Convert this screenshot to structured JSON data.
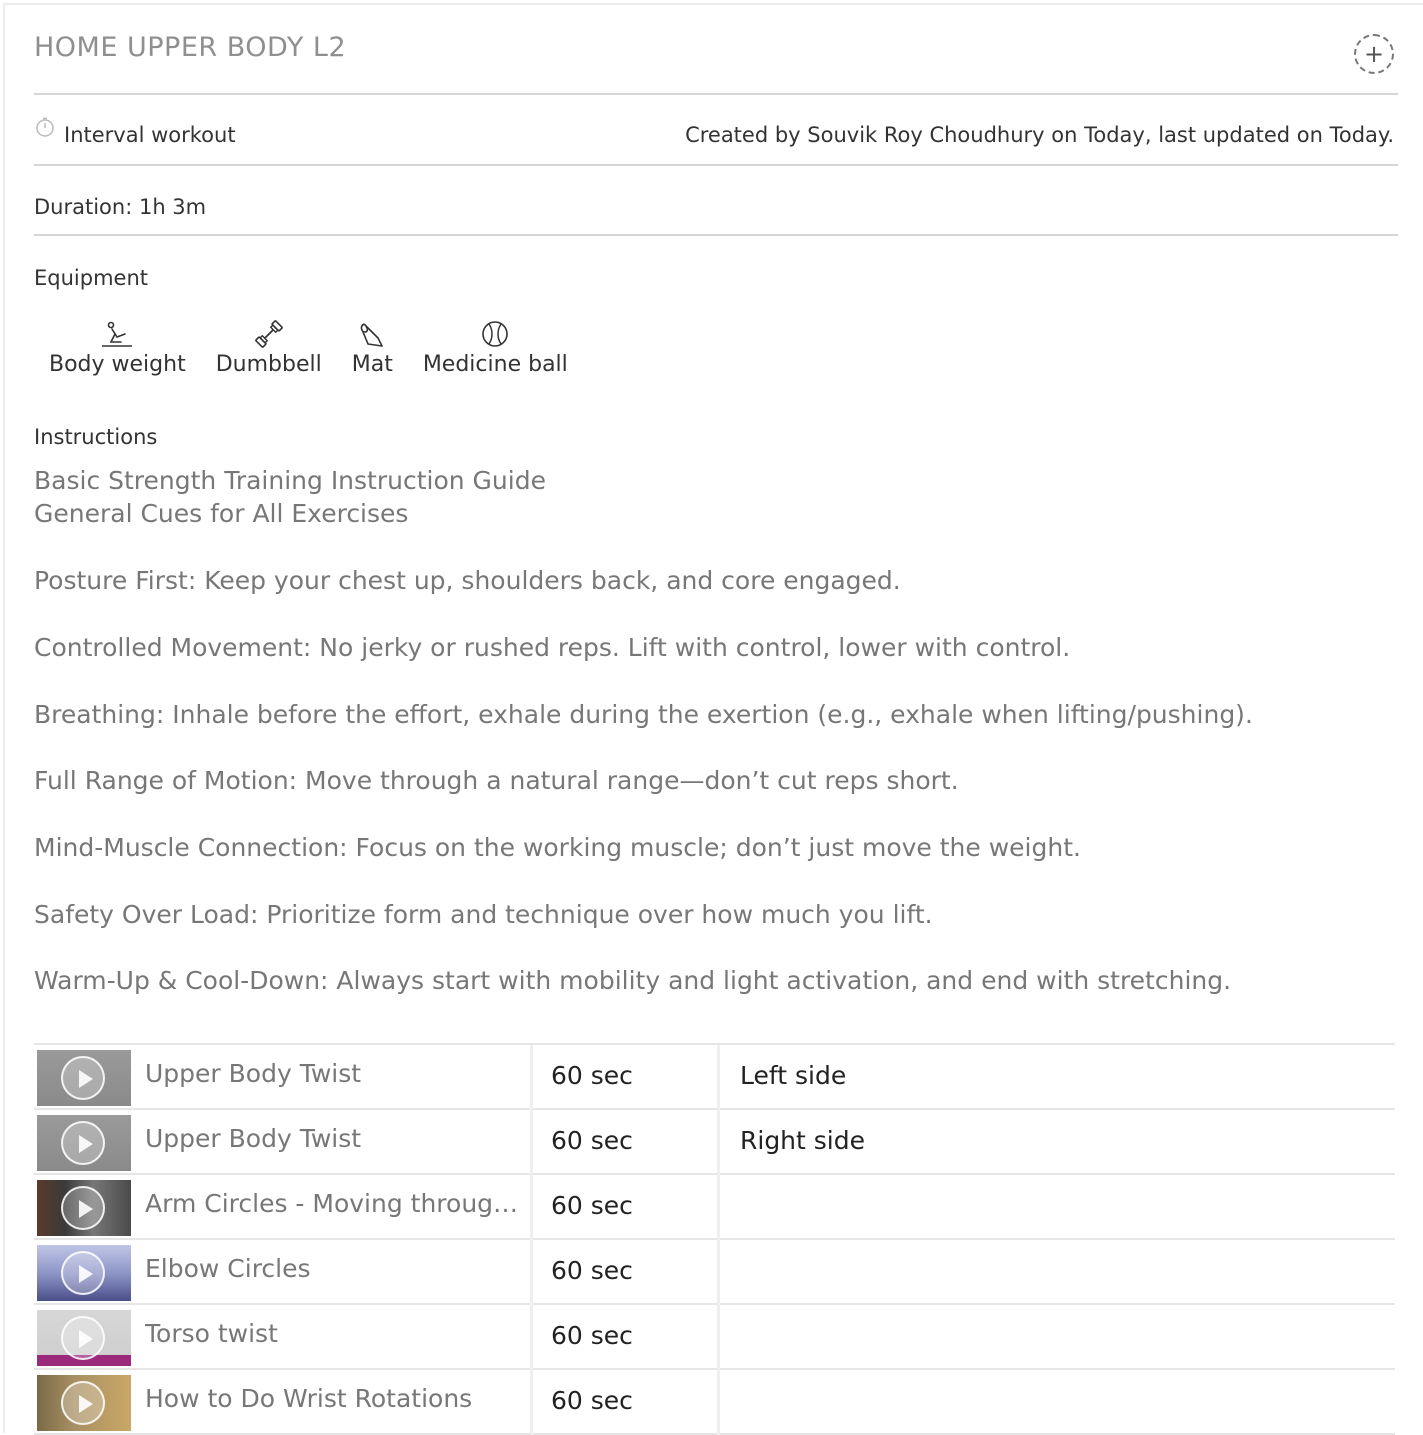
{
  "workout": {
    "title": "HOME UPPER BODY L2",
    "type": "Interval workout",
    "created": "Created by Souvik Roy Choudhury on Today, last updated on Today.",
    "duration": "Duration: 1h 3m"
  },
  "equipment": {
    "heading": "Equipment",
    "items": [
      {
        "label": "Body weight",
        "icon": "body-weight-icon"
      },
      {
        "label": "Dumbbell",
        "icon": "dumbbell-icon"
      },
      {
        "label": "Mat",
        "icon": "mat-icon"
      },
      {
        "label": "Medicine ball",
        "icon": "medicine-ball-icon"
      }
    ]
  },
  "instructions": {
    "heading": "Instructions",
    "lines": [
      "Basic Strength Training Instruction Guide",
      "General Cues for All Exercises",
      "Posture First: Keep your chest up, shoulders back, and core engaged.",
      "Controlled Movement: No jerky or rushed reps. Lift with control, lower with control.",
      "Breathing: Inhale before the effort, exhale during the exertion (e.g., exhale when lifting/pushing).",
      "Full Range of Motion: Move through a natural range—don’t cut reps short.",
      "Mind-Muscle Connection: Focus on the working muscle; don’t just move the weight.",
      "Safety Over Load: Prioritize form and technique over how much you lift.",
      "Warm-Up & Cool-Down: Always start with mobility and light activation, and end with stretching."
    ]
  },
  "exercises": [
    {
      "name": "Upper Body Twist",
      "duration": "60 sec",
      "note": "Left side"
    },
    {
      "name": "Upper Body Twist",
      "duration": "60 sec",
      "note": "Right side"
    },
    {
      "name": "Arm Circles - Moving through...",
      "duration": "60 sec",
      "note": ""
    },
    {
      "name": "Elbow Circles",
      "duration": "60 sec",
      "note": ""
    },
    {
      "name": "Torso twist",
      "duration": "60 sec",
      "note": ""
    },
    {
      "name": "How to Do Wrist Rotations",
      "duration": "60 sec",
      "note": ""
    }
  ]
}
